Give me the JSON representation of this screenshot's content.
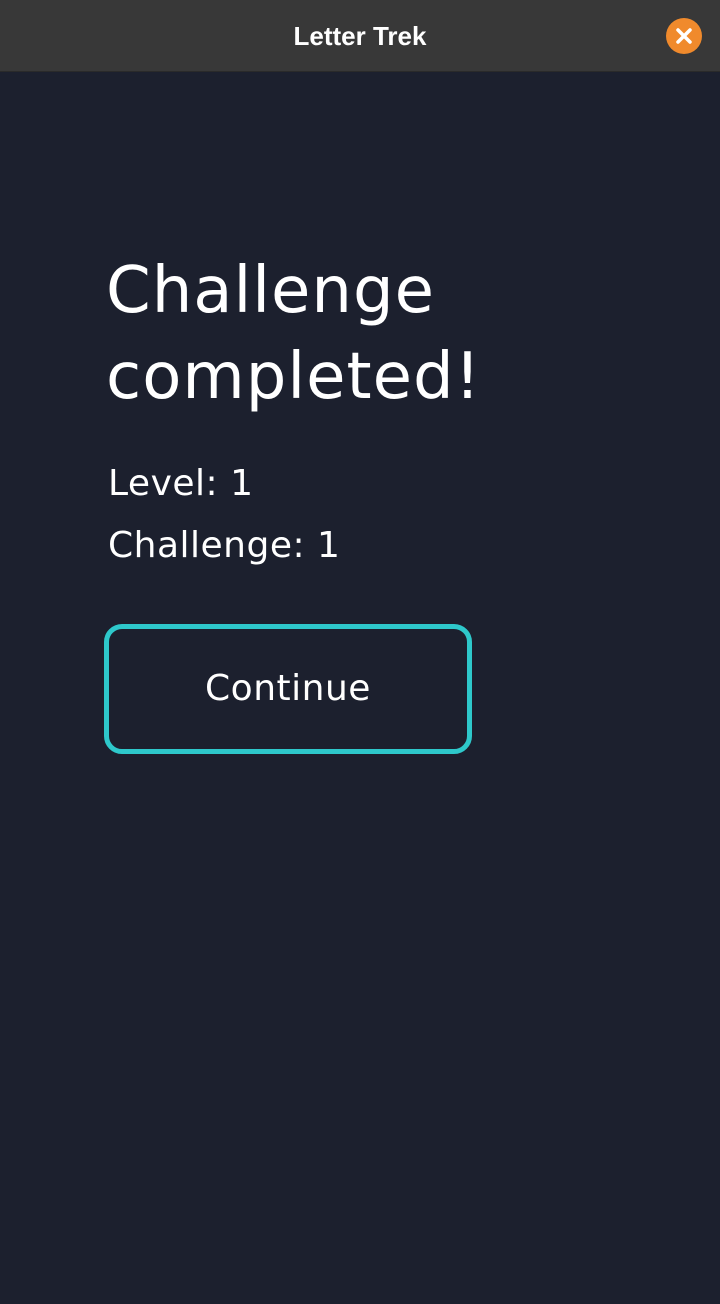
{
  "window": {
    "title": "Letter Trek",
    "close_icon": "close-icon",
    "close_color": "#f08a2c"
  },
  "main": {
    "heading": "Challenge completed!",
    "level_text": "Level: 1",
    "challenge_text": "Challenge: 1",
    "continue_label": "Continue"
  },
  "colors": {
    "background": "#1c202e",
    "titlebar": "#383838",
    "button_border": "#2ec8cb",
    "text": "#ffffff"
  }
}
